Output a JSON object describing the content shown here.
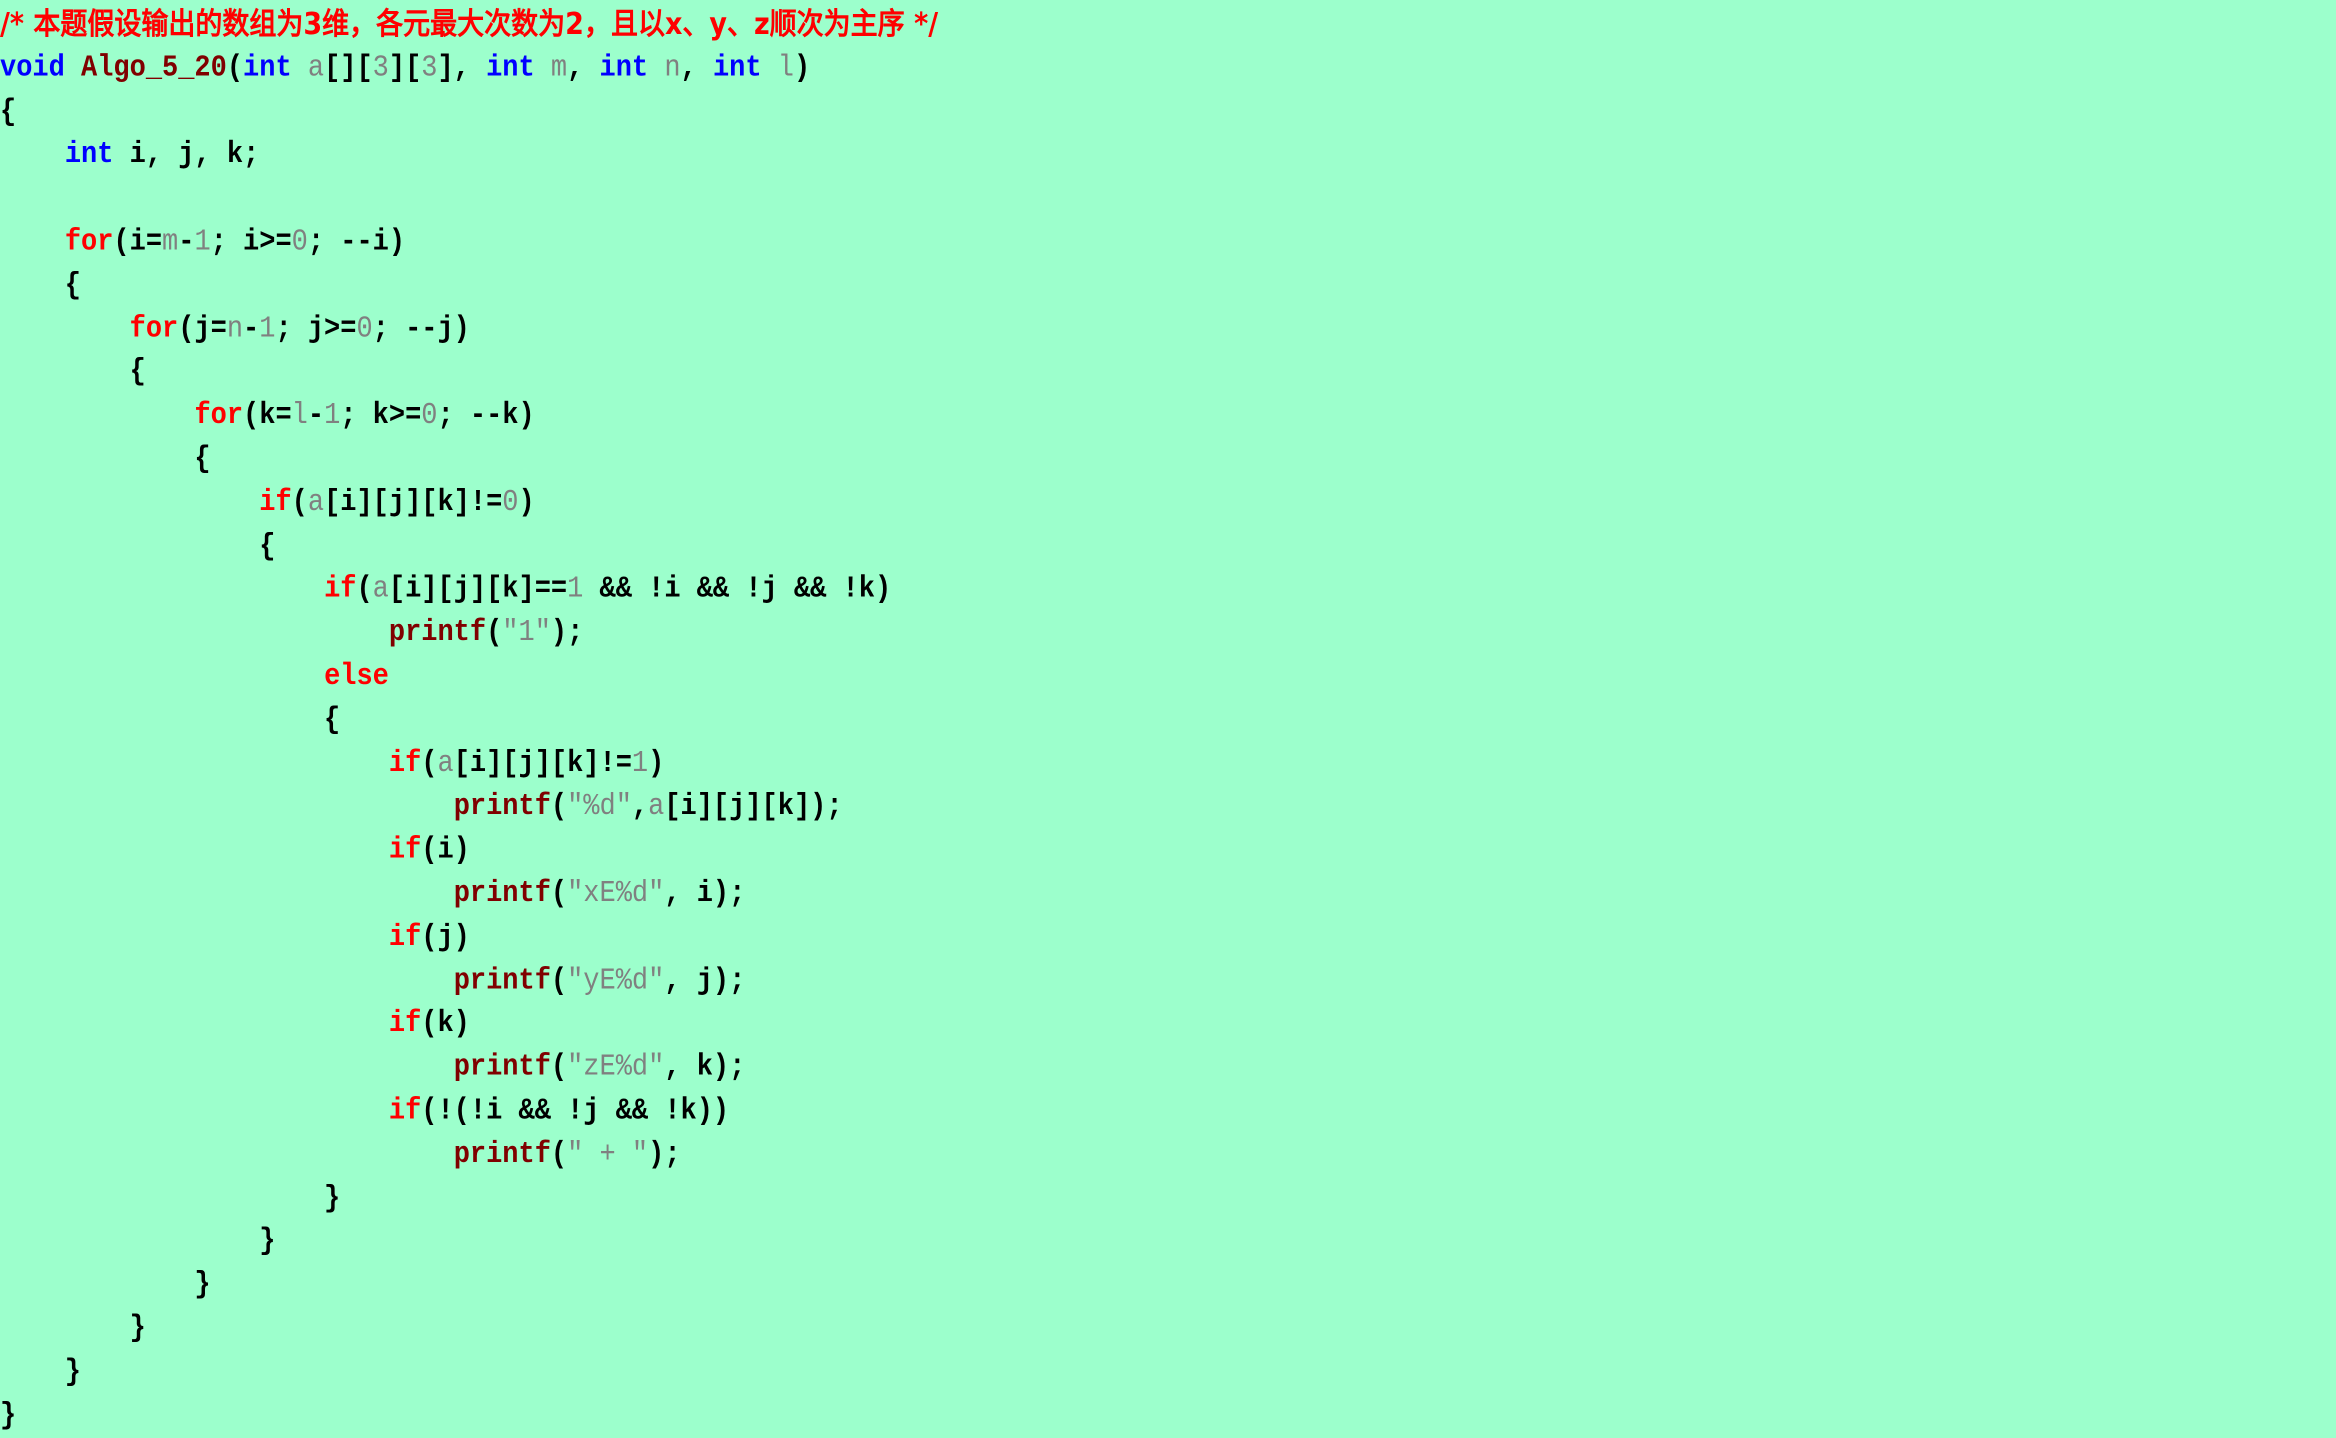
{
  "colors": {
    "background": "#9cffcc",
    "comment": "#ff0000",
    "type_keyword": "#0000ff",
    "control_keyword": "#ff0000",
    "function_name": "#800000",
    "identifier_literal": "#808080",
    "plain": "#000000"
  },
  "code": {
    "lines": [
      [
        {
          "t": "/* 本题假设输出的数组为3维，各元最大次数为2，且以x、y、z顺次为主序 */",
          "c": "cmt"
        }
      ],
      [
        {
          "t": "void",
          "c": "kw-blue"
        },
        {
          "t": " ",
          "c": "plain"
        },
        {
          "t": "Algo_5_20",
          "c": "fn"
        },
        {
          "t": "(",
          "c": "plain"
        },
        {
          "t": "int",
          "c": "kw-blue"
        },
        {
          "t": " ",
          "c": "plain"
        },
        {
          "t": "a",
          "c": "var"
        },
        {
          "t": "[][",
          "c": "plain"
        },
        {
          "t": "3",
          "c": "var"
        },
        {
          "t": "][",
          "c": "plain"
        },
        {
          "t": "3",
          "c": "var"
        },
        {
          "t": "], ",
          "c": "plain"
        },
        {
          "t": "int",
          "c": "kw-blue"
        },
        {
          "t": " ",
          "c": "plain"
        },
        {
          "t": "m",
          "c": "var"
        },
        {
          "t": ", ",
          "c": "plain"
        },
        {
          "t": "int",
          "c": "kw-blue"
        },
        {
          "t": " ",
          "c": "plain"
        },
        {
          "t": "n",
          "c": "var"
        },
        {
          "t": ", ",
          "c": "plain"
        },
        {
          "t": "int",
          "c": "kw-blue"
        },
        {
          "t": " ",
          "c": "plain"
        },
        {
          "t": "l",
          "c": "var"
        },
        {
          "t": ")",
          "c": "plain"
        }
      ],
      [
        {
          "t": "{",
          "c": "plain"
        }
      ],
      [
        {
          "t": "    ",
          "c": "plain"
        },
        {
          "t": "int",
          "c": "kw-blue"
        },
        {
          "t": " i, j, k;",
          "c": "plain"
        }
      ],
      [
        {
          "t": "",
          "c": "plain"
        }
      ],
      [
        {
          "t": "    ",
          "c": "plain"
        },
        {
          "t": "for",
          "c": "kw-red"
        },
        {
          "t": "(i=",
          "c": "plain"
        },
        {
          "t": "m",
          "c": "var"
        },
        {
          "t": "-",
          "c": "plain"
        },
        {
          "t": "1",
          "c": "var"
        },
        {
          "t": "; i>=",
          "c": "plain"
        },
        {
          "t": "0",
          "c": "var"
        },
        {
          "t": "; --i)",
          "c": "plain"
        }
      ],
      [
        {
          "t": "    {",
          "c": "plain"
        }
      ],
      [
        {
          "t": "        ",
          "c": "plain"
        },
        {
          "t": "for",
          "c": "kw-red"
        },
        {
          "t": "(j=",
          "c": "plain"
        },
        {
          "t": "n",
          "c": "var"
        },
        {
          "t": "-",
          "c": "plain"
        },
        {
          "t": "1",
          "c": "var"
        },
        {
          "t": "; j>=",
          "c": "plain"
        },
        {
          "t": "0",
          "c": "var"
        },
        {
          "t": "; --j)",
          "c": "plain"
        }
      ],
      [
        {
          "t": "        {",
          "c": "plain"
        }
      ],
      [
        {
          "t": "            ",
          "c": "plain"
        },
        {
          "t": "for",
          "c": "kw-red"
        },
        {
          "t": "(k=",
          "c": "plain"
        },
        {
          "t": "l",
          "c": "var"
        },
        {
          "t": "-",
          "c": "plain"
        },
        {
          "t": "1",
          "c": "var"
        },
        {
          "t": "; k>=",
          "c": "plain"
        },
        {
          "t": "0",
          "c": "var"
        },
        {
          "t": "; --k)",
          "c": "plain"
        }
      ],
      [
        {
          "t": "            {",
          "c": "plain"
        }
      ],
      [
        {
          "t": "                ",
          "c": "plain"
        },
        {
          "t": "if",
          "c": "kw-red"
        },
        {
          "t": "(",
          "c": "plain"
        },
        {
          "t": "a",
          "c": "var"
        },
        {
          "t": "[i][j][k]!=",
          "c": "plain"
        },
        {
          "t": "0",
          "c": "var"
        },
        {
          "t": ")",
          "c": "plain"
        }
      ],
      [
        {
          "t": "                {",
          "c": "plain"
        }
      ],
      [
        {
          "t": "                    ",
          "c": "plain"
        },
        {
          "t": "if",
          "c": "kw-red"
        },
        {
          "t": "(",
          "c": "plain"
        },
        {
          "t": "a",
          "c": "var"
        },
        {
          "t": "[i][j][k]==",
          "c": "plain"
        },
        {
          "t": "1",
          "c": "var"
        },
        {
          "t": " && !i && !j && !k)",
          "c": "plain"
        }
      ],
      [
        {
          "t": "                        ",
          "c": "plain"
        },
        {
          "t": "printf",
          "c": "fn"
        },
        {
          "t": "(",
          "c": "plain"
        },
        {
          "t": "\"1\"",
          "c": "var"
        },
        {
          "t": ");",
          "c": "plain"
        }
      ],
      [
        {
          "t": "                    ",
          "c": "plain"
        },
        {
          "t": "else",
          "c": "kw-red"
        }
      ],
      [
        {
          "t": "                    {",
          "c": "plain"
        }
      ],
      [
        {
          "t": "                        ",
          "c": "plain"
        },
        {
          "t": "if",
          "c": "kw-red"
        },
        {
          "t": "(",
          "c": "plain"
        },
        {
          "t": "a",
          "c": "var"
        },
        {
          "t": "[i][j][k]!=",
          "c": "plain"
        },
        {
          "t": "1",
          "c": "var"
        },
        {
          "t": ")",
          "c": "plain"
        }
      ],
      [
        {
          "t": "                            ",
          "c": "plain"
        },
        {
          "t": "printf",
          "c": "fn"
        },
        {
          "t": "(",
          "c": "plain"
        },
        {
          "t": "\"%d\"",
          "c": "var"
        },
        {
          "t": ",",
          "c": "plain"
        },
        {
          "t": "a",
          "c": "var"
        },
        {
          "t": "[i][j][k]);",
          "c": "plain"
        }
      ],
      [
        {
          "t": "                        ",
          "c": "plain"
        },
        {
          "t": "if",
          "c": "kw-red"
        },
        {
          "t": "(i)",
          "c": "plain"
        }
      ],
      [
        {
          "t": "                            ",
          "c": "plain"
        },
        {
          "t": "printf",
          "c": "fn"
        },
        {
          "t": "(",
          "c": "plain"
        },
        {
          "t": "\"xE%d\"",
          "c": "var"
        },
        {
          "t": ", i);",
          "c": "plain"
        }
      ],
      [
        {
          "t": "                        ",
          "c": "plain"
        },
        {
          "t": "if",
          "c": "kw-red"
        },
        {
          "t": "(j)",
          "c": "plain"
        }
      ],
      [
        {
          "t": "                            ",
          "c": "plain"
        },
        {
          "t": "printf",
          "c": "fn"
        },
        {
          "t": "(",
          "c": "plain"
        },
        {
          "t": "\"yE%d\"",
          "c": "var"
        },
        {
          "t": ", j);",
          "c": "plain"
        }
      ],
      [
        {
          "t": "                        ",
          "c": "plain"
        },
        {
          "t": "if",
          "c": "kw-red"
        },
        {
          "t": "(k)",
          "c": "plain"
        }
      ],
      [
        {
          "t": "                            ",
          "c": "plain"
        },
        {
          "t": "printf",
          "c": "fn"
        },
        {
          "t": "(",
          "c": "plain"
        },
        {
          "t": "\"zE%d\"",
          "c": "var"
        },
        {
          "t": ", k);",
          "c": "plain"
        }
      ],
      [
        {
          "t": "                        ",
          "c": "plain"
        },
        {
          "t": "if",
          "c": "kw-red"
        },
        {
          "t": "(!(!i && !j && !k))",
          "c": "plain"
        }
      ],
      [
        {
          "t": "                            ",
          "c": "plain"
        },
        {
          "t": "printf",
          "c": "fn"
        },
        {
          "t": "(",
          "c": "plain"
        },
        {
          "t": "\" + \"",
          "c": "var"
        },
        {
          "t": ");",
          "c": "plain"
        }
      ],
      [
        {
          "t": "                    }",
          "c": "plain"
        }
      ],
      [
        {
          "t": "                }",
          "c": "plain"
        }
      ],
      [
        {
          "t": "            }",
          "c": "plain"
        }
      ],
      [
        {
          "t": "        }",
          "c": "plain"
        }
      ],
      [
        {
          "t": "    }",
          "c": "plain"
        }
      ],
      [
        {
          "t": "}",
          "c": "plain"
        }
      ]
    ]
  }
}
